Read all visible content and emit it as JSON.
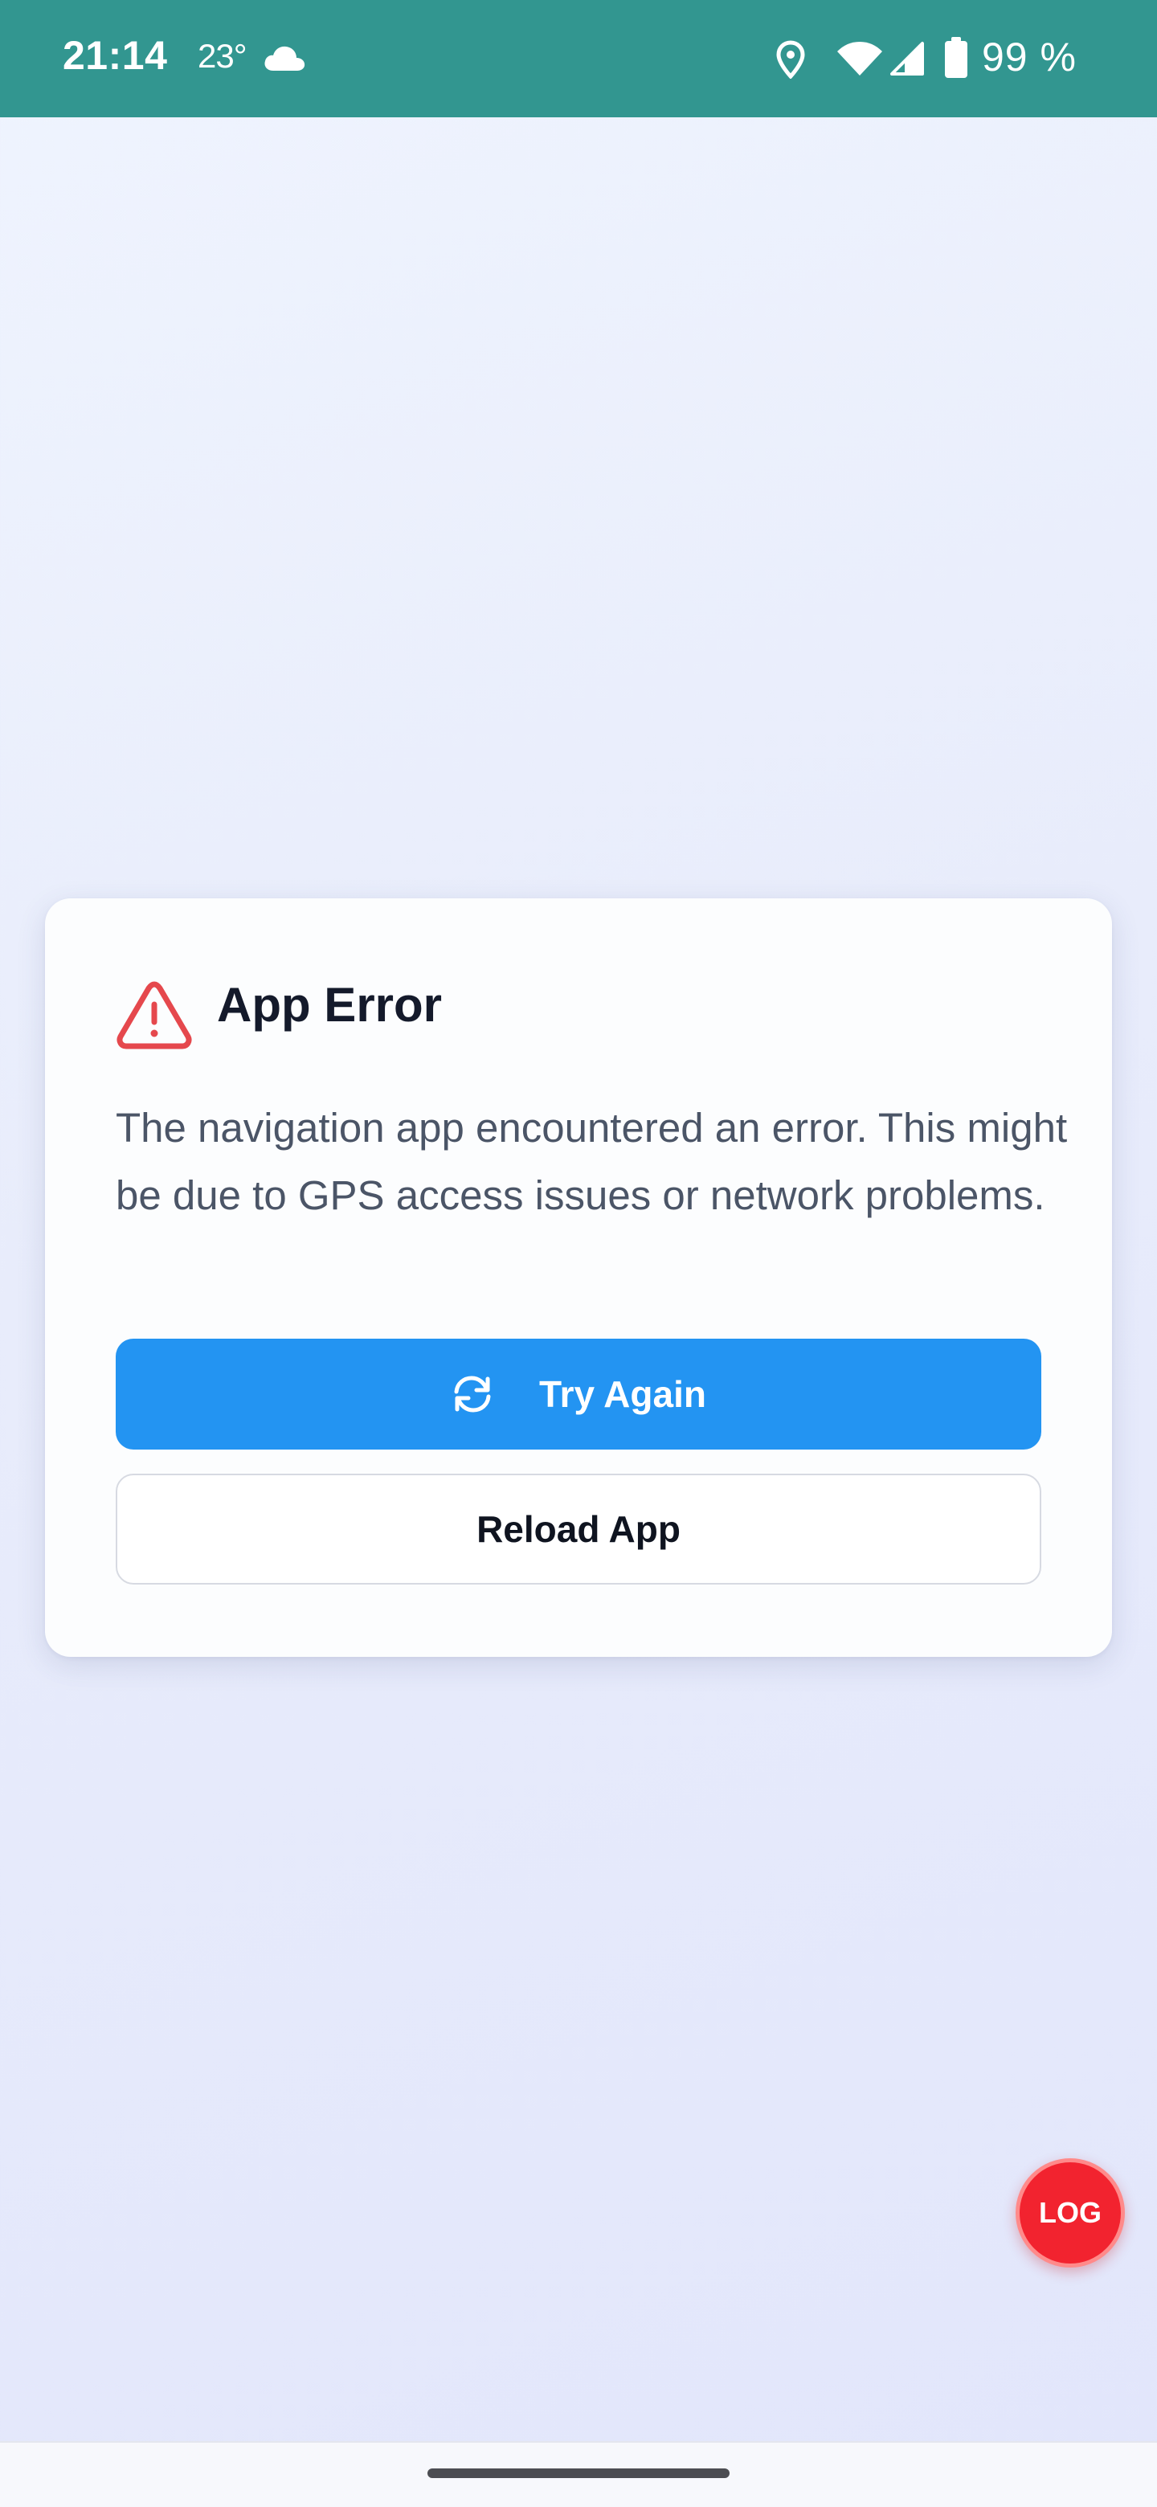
{
  "status_bar": {
    "time": "21:14",
    "temperature": "23°",
    "weather_icon": "cloud-icon",
    "battery_percent": "99 %",
    "icons": [
      "location-icon",
      "wifi-icon",
      "cellular-signal-icon",
      "battery-icon"
    ]
  },
  "error_card": {
    "icon": "warning-triangle-icon",
    "title": "App Error",
    "message": "The navigation app encountered an error. This might be due to GPS access issues or network problems.",
    "primary_button": {
      "icon": "refresh-icon",
      "label": "Try Again"
    },
    "secondary_button": {
      "label": "Reload App"
    }
  },
  "log_button": {
    "label": "LOG"
  },
  "colors": {
    "status_bar": "#329690",
    "primary": "#2394f2",
    "error": "#e5484d",
    "log_button": "#f2232f"
  }
}
